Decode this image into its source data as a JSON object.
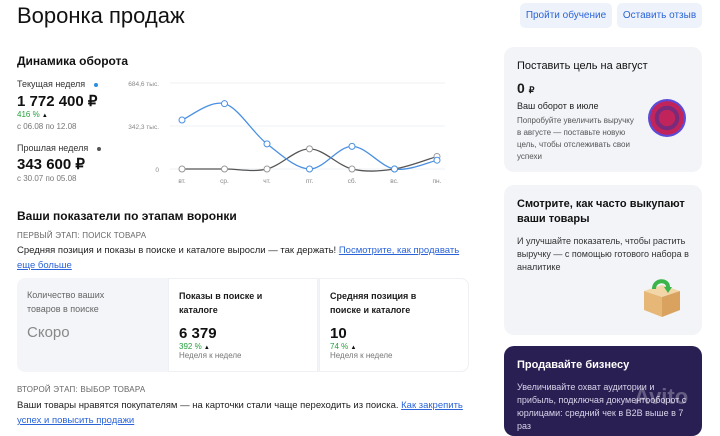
{
  "header": {
    "title": "Воронка продаж",
    "btn_training": "Пройти обучение",
    "btn_feedback": "Оставить отзыв"
  },
  "turnover": {
    "title": "Динамика оборота",
    "current": {
      "label": "Текущая неделя",
      "value": "1 772 400 ₽",
      "pct": "416 %",
      "pct_arrow": "▲",
      "period": "с 06.08 по 12.08"
    },
    "previous": {
      "label": "Прошлая неделя",
      "value": "343 600 ₽",
      "period": "с 30.07 по 05.08"
    }
  },
  "chart_data": {
    "type": "line",
    "categories": [
      "вт.",
      "ср.",
      "чт.",
      "пт.",
      "сб.",
      "вс.",
      "пн."
    ],
    "y_tick_labels": [
      "684,6 тыс.",
      "342,3 тыс.",
      "0"
    ],
    "ylim": [
      0,
      684.6
    ],
    "series": [
      {
        "values": [
          390,
          520,
          200,
          0,
          180,
          0,
          70
        ],
        "color": "#4a90e2"
      },
      {
        "values": [
          0,
          0,
          0,
          160,
          0,
          0,
          100
        ],
        "color": "#555555"
      }
    ]
  },
  "funnel": {
    "title": "Ваши показатели по этапам воронки",
    "stage1": {
      "caps": "ПЕРВЫЙ ЭТАП: ПОИСК ТОВАРА",
      "text": "Средняя позиция и показы в поиске и каталоге выросли — так держать!",
      "link": "Посмотрите, как продавать еще больше"
    },
    "cards": [
      {
        "title": "Количество ваших товаров в поиске",
        "value": "Скоро",
        "pct": "",
        "sub": ""
      },
      {
        "title": "Показы в поиске и каталоге",
        "value": "6 379",
        "pct": "392 %",
        "sub": "Неделя к неделе"
      },
      {
        "title": "Средняя позиция в поиске и каталоге",
        "value": "10",
        "pct": "74 %",
        "sub": "Неделя к неделе"
      }
    ],
    "arrow": "▲",
    "stage2": {
      "caps": "ВТОРОЙ ЭТАП: ВЫБОР ТОВАРА",
      "text": "Ваши товары нравятся покупателям — на карточки стали чаще переходить из поиска.",
      "link": "Как закрепить успех и повысить продажи"
    }
  },
  "sidebar": {
    "goal": {
      "title": "Поставить цель на август",
      "value": "0",
      "currency": "₽",
      "sub": "Ваш оборот в июле",
      "desc": "Попробуйте увеличить выручку в августе — поставьте новую цель, чтобы отслеживать свои успехи"
    },
    "buyout": {
      "title": "Смотрите, как часто выкупают ваши товары",
      "desc": "И улучшайте показатель, чтобы растить выручку — с помощью готового набора в аналитике"
    },
    "business": {
      "title": "Продавайте бизнесу",
      "desc": "Увеличивайте охват аудитории и прибыль, подключая документооборот с юрлицами: средний чек в B2B выше в 7 раз"
    },
    "watermark": "Avito",
    "colors": {
      "goal_bg": "#f2f4f8",
      "business_bg": "#2a1f52",
      "accent": "#2b64d8",
      "positive": "#23a13b"
    }
  }
}
